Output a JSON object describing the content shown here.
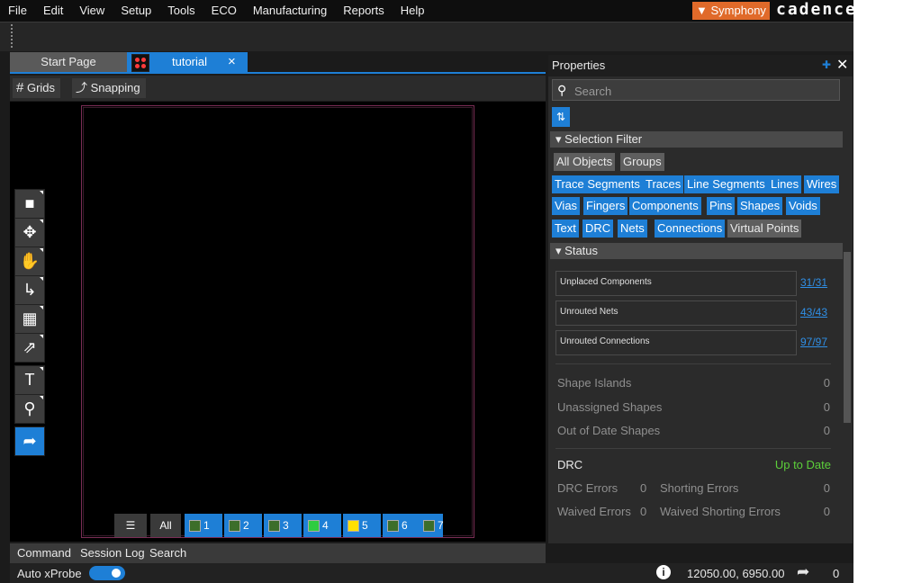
{
  "menu": [
    "File",
    "Edit",
    "View",
    "Setup",
    "Tools",
    "ECO",
    "Manufacturing",
    "Reports",
    "Help"
  ],
  "brand": {
    "symphony": "Symphony",
    "cadence": "cadence"
  },
  "tabs": {
    "start": "Start Page",
    "tutorial": "tutorial",
    "close": "×"
  },
  "canvas_toolbar": {
    "grids": "Grids",
    "snapping": "Snapping"
  },
  "left_tools": [
    "comment-icon",
    "move-icon",
    "hand-icon",
    "route-icon",
    "add-shape-icon",
    "slide-icon",
    "text-icon",
    "zoom-icon",
    "select-pointer-icon"
  ],
  "layers": {
    "all": "All",
    "items": [
      {
        "num": "1",
        "color": "#3c6e2a"
      },
      {
        "num": "2",
        "color": "#3c6e2a"
      },
      {
        "num": "3",
        "color": "#3c6e2a"
      },
      {
        "num": "4",
        "color": "#2ecc40"
      },
      {
        "num": "5",
        "color": "#ffe000"
      },
      {
        "num": "6",
        "color": "#3c6e2a"
      },
      {
        "num": "7",
        "color": "#3c6e2a"
      }
    ]
  },
  "bottom_tabs": [
    "Command",
    "Session Log",
    "Search"
  ],
  "status": {
    "auto_xprobe": "Auto xProbe",
    "coords": "12050.00, 6950.00",
    "pick_count": "0"
  },
  "properties": {
    "title": "Properties",
    "search_placeholder": "Search",
    "selection_filter": {
      "heading": "Selection Filter",
      "chips": [
        {
          "label": "All Objects",
          "on": false
        },
        {
          "label": "Groups",
          "on": false
        },
        {
          "label": "Trace Segments",
          "on": true
        },
        {
          "label": "Traces",
          "on": true
        },
        {
          "label": "Line Segments",
          "on": true
        },
        {
          "label": "Lines",
          "on": true
        },
        {
          "label": "Wires",
          "on": true
        },
        {
          "label": "Vias",
          "on": true
        },
        {
          "label": "Fingers",
          "on": true
        },
        {
          "label": "Components",
          "on": true
        },
        {
          "label": "Pins",
          "on": true
        },
        {
          "label": "Shapes",
          "on": true
        },
        {
          "label": "Voids",
          "on": true
        },
        {
          "label": "Text",
          "on": true
        },
        {
          "label": "DRC",
          "on": true
        },
        {
          "label": "Nets",
          "on": true
        },
        {
          "label": "Connections",
          "on": true
        },
        {
          "label": "Virtual Points",
          "on": false
        }
      ]
    },
    "status": {
      "heading": "Status",
      "rows": [
        {
          "label": "Unplaced Components",
          "value": "31/31"
        },
        {
          "label": "Unrouted Nets",
          "value": "43/43"
        },
        {
          "label": "Unrouted Connections",
          "value": "97/97"
        }
      ],
      "shape_stats": [
        {
          "label": "Shape Islands",
          "value": "0"
        },
        {
          "label": "Unassigned Shapes",
          "value": "0"
        },
        {
          "label": "Out of Date Shapes",
          "value": "0"
        }
      ],
      "drc": {
        "label": "DRC",
        "state": "Up to Date",
        "state_color": "#5ccf3a",
        "drc_errors_label": "DRC Errors",
        "drc_errors": "0",
        "shorting_label": "Shorting Errors",
        "shorting": "0",
        "waived_label": "Waived Errors",
        "waived": "0",
        "waived_short_label": "Waived Shorting Errors",
        "waived_short": "0"
      }
    }
  }
}
